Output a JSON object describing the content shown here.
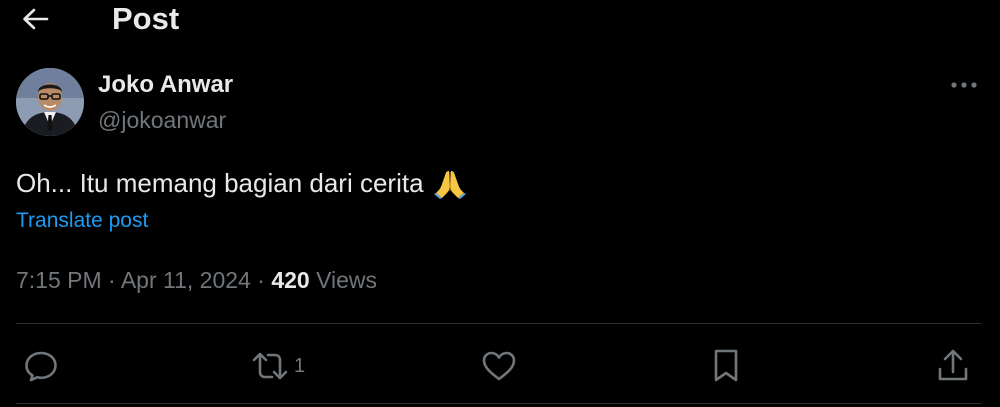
{
  "header": {
    "title": "Post",
    "back_icon": "arrow-left-icon"
  },
  "author": {
    "display_name": "Joko Anwar",
    "handle": "@jokoanwar"
  },
  "post": {
    "text": "Oh... Itu memang bagian dari cerita",
    "emoji": "folded-hands-icon",
    "translate_label": "Translate post"
  },
  "meta": {
    "time": "7:15 PM",
    "separator": "·",
    "date": "Apr 11, 2024",
    "views_count": "420",
    "views_label": "Views"
  },
  "actions": {
    "reply_icon": "reply-icon",
    "repost_icon": "repost-icon",
    "repost_count": "1",
    "like_icon": "heart-icon",
    "bookmark_icon": "bookmark-icon",
    "share_icon": "share-icon"
  },
  "colors": {
    "background": "#000000",
    "text_primary": "#e7e9ea",
    "text_secondary": "#71767b",
    "accent": "#1d9bf0",
    "divider": "#2f3336"
  }
}
